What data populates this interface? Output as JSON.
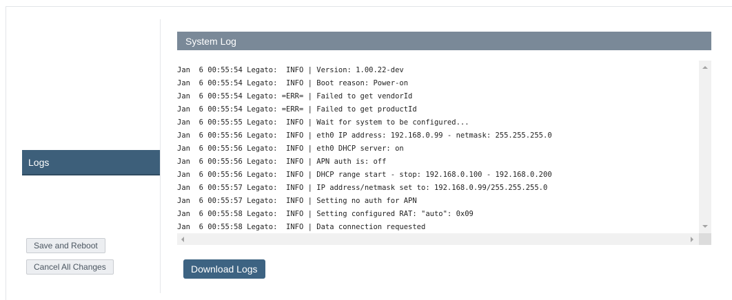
{
  "panel": {
    "title": "System Log"
  },
  "sidebar": {
    "nav_items": [
      {
        "label": "Logs",
        "active": true
      }
    ],
    "save_label": "Save and Reboot",
    "cancel_label": "Cancel All Changes"
  },
  "log": {
    "lines": [
      "Jan  6 00:55:54 Legato:  INFO | Version: 1.00.22-dev",
      "Jan  6 00:55:54 Legato:  INFO | Boot reason: Power-on",
      "Jan  6 00:55:54 Legato: =ERR= | Failed to get vendorId",
      "Jan  6 00:55:54 Legato: =ERR= | Failed to get productId",
      "Jan  6 00:55:55 Legato:  INFO | Wait for system to be configured...",
      "Jan  6 00:55:56 Legato:  INFO | eth0 IP address: 192.168.0.99 - netmask: 255.255.255.0",
      "Jan  6 00:55:56 Legato:  INFO | eth0 DHCP server: on",
      "Jan  6 00:55:56 Legato:  INFO | APN auth is: off",
      "Jan  6 00:55:56 Legato:  INFO | DHCP range start - stop: 192.168.0.100 - 192.168.0.200",
      "Jan  6 00:55:57 Legato:  INFO | IP address/netmask set to: 192.168.0.99/255.255.255.0",
      "Jan  6 00:55:57 Legato:  INFO | Setting no auth for APN",
      "Jan  6 00:55:58 Legato:  INFO | Setting configured RAT: \"auto\": 0x09",
      "Jan  6 00:55:58 Legato:  INFO | Data connection requested"
    ]
  },
  "actions": {
    "download_label": "Download Logs"
  },
  "colors": {
    "header_bg": "#7a8998",
    "nav_active_bg": "#3d5f7a",
    "primary_button": "#3d6382"
  },
  "icons": [
    "chevron-up-icon",
    "chevron-down-icon",
    "chevron-left-icon",
    "chevron-right-icon"
  ]
}
